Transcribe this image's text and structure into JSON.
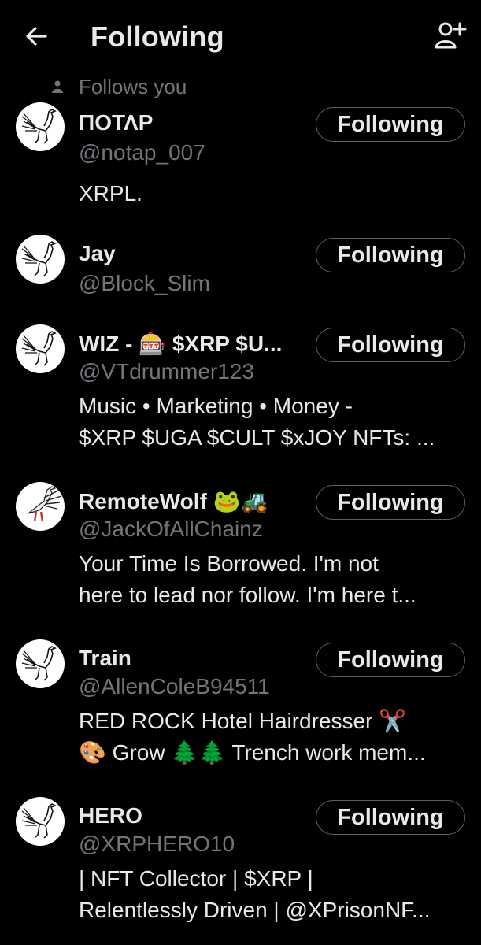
{
  "header": {
    "title": "Following",
    "back_icon": "arrow-left-icon",
    "add_icon": "add-user-icon"
  },
  "follows_you_label": "Follows you",
  "button_label": "Following",
  "users": [
    {
      "name": "ΠΟΤΛΡ",
      "handle": "@notap_007",
      "bio": [
        "XRPL."
      ]
    },
    {
      "name": "Jay",
      "handle": "@Block_Slim",
      "bio": []
    },
    {
      "name": "WIZ - 🎰 $XRP $U...",
      "handle": "@VTdrummer123",
      "bio": [
        "Music • Marketing • Money -",
        "$XRP $UGA $CULT $xJOY NFTs: ..."
      ]
    },
    {
      "name": "RemoteWolf 🐸🚜",
      "handle": "@JackOfAllChainz",
      "bio": [
        "Your Time Is Borrowed. I'm not",
        "here to lead nor follow. I'm here t..."
      ]
    },
    {
      "name": "Train",
      "handle": "@AllenColeB94511",
      "bio": [
        "RED ROCK Hotel Hairdresser ✂️",
        "🎨 Grow 🌲🌲 Trench work mem..."
      ]
    },
    {
      "name": "HERO",
      "handle": "@XRPHERO10",
      "bio": [
        "| NFT Collector | $XRP |",
        "Relentlessly Driven | @XPrisonNF..."
      ]
    }
  ]
}
